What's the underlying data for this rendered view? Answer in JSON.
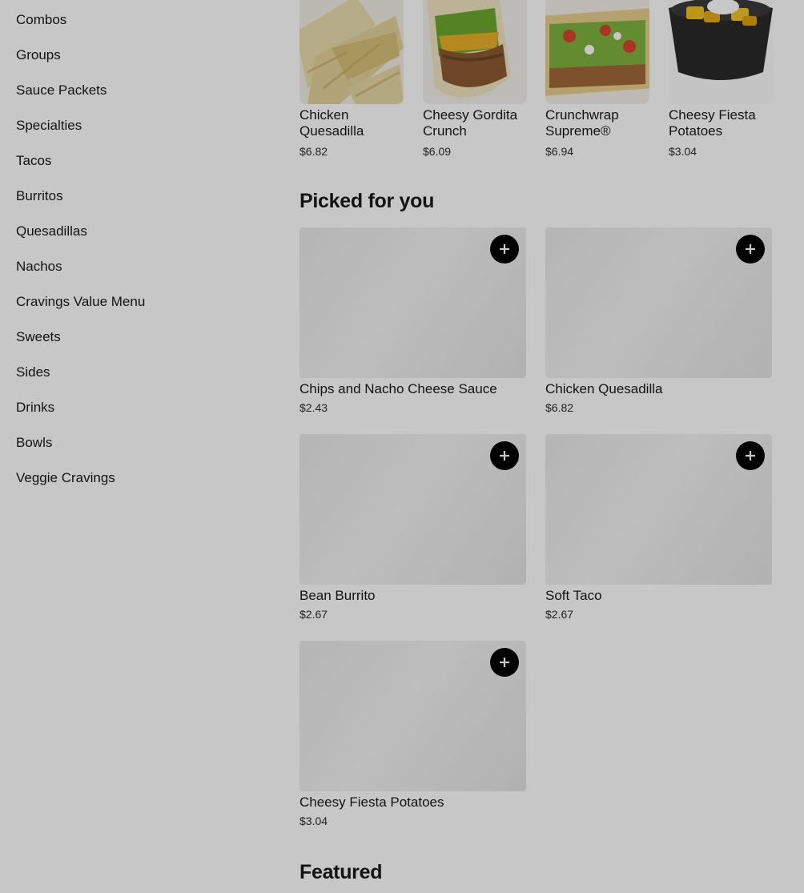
{
  "sidebar": {
    "categories": [
      "Combos",
      "Groups",
      "Sauce Packets",
      "Specialties",
      "Tacos",
      "Burritos",
      "Quesadillas",
      "Nachos",
      "Cravings Value Menu",
      "Sweets",
      "Sides",
      "Drinks",
      "Bowls",
      "Veggie Cravings"
    ]
  },
  "top_items": [
    {
      "name": "Chicken Quesadilla",
      "price": "$6.82"
    },
    {
      "name": "Cheesy Gordita Crunch",
      "price": "$6.09"
    },
    {
      "name": "Crunchwrap Supreme®",
      "price": "$6.94"
    },
    {
      "name": "Cheesy Fiesta Potatoes",
      "price": "$3.04"
    }
  ],
  "picked": {
    "title": "Picked for you",
    "items": [
      {
        "name": "Chips and Nacho Cheese Sauce",
        "price": "$2.43"
      },
      {
        "name": "Chicken Quesadilla",
        "price": "$6.82"
      },
      {
        "name": "Bean Burrito",
        "price": "$2.67"
      },
      {
        "name": "Soft Taco",
        "price": "$2.67"
      },
      {
        "name": "Cheesy Fiesta Potatoes",
        "price": "$3.04"
      }
    ]
  },
  "featured": {
    "title": "Featured"
  },
  "icons": {
    "add": "plus-icon"
  },
  "colors": {
    "overlay": "rgba(0,0,0,0.22)",
    "button": "#000000"
  }
}
